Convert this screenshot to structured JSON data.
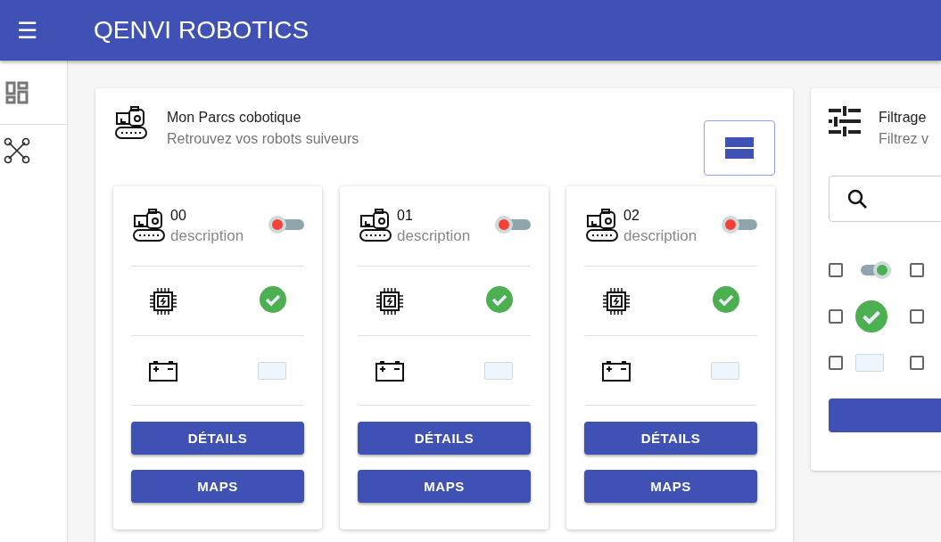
{
  "app_bar": {
    "menu_icon": "☰",
    "title": "QENVI ROBOTICS"
  },
  "sidebar": {
    "items": [
      {
        "kind": "dashboard",
        "selected": false
      },
      {
        "kind": "tools",
        "selected": false
      }
    ]
  },
  "fleet_panel": {
    "title": "Mon Parcs cobotique",
    "subtitle": "Retrouvez vos robots suiveurs",
    "robots": [
      {
        "id": "00",
        "description": "description",
        "on": false,
        "cpu_ok": true,
        "battery": {
          "level": 0
        },
        "buttons": [
          "DÉTAILS",
          "MAPS"
        ]
      },
      {
        "id": "01",
        "description": "description",
        "on": false,
        "cpu_ok": true,
        "battery": {
          "level": 0
        },
        "buttons": [
          "DÉTAILS",
          "MAPS"
        ]
      },
      {
        "id": "02",
        "description": "description",
        "on": false,
        "cpu_ok": true,
        "battery": {
          "level": 0
        },
        "buttons": [
          "DÉTAILS",
          "MAPS"
        ]
      }
    ]
  },
  "filter_panel": {
    "title": "Filtrage",
    "subtitle": "Filtrez v",
    "filters": [
      {
        "kind": "toggle",
        "checked": false,
        "on": true
      },
      {
        "kind": "plain",
        "checked": false
      },
      {
        "kind": "check",
        "checked": false
      },
      {
        "kind": "plain",
        "checked": false
      },
      {
        "kind": "battery",
        "checked": false,
        "level": 0
      },
      {
        "kind": "plain",
        "checked": false
      }
    ]
  }
}
